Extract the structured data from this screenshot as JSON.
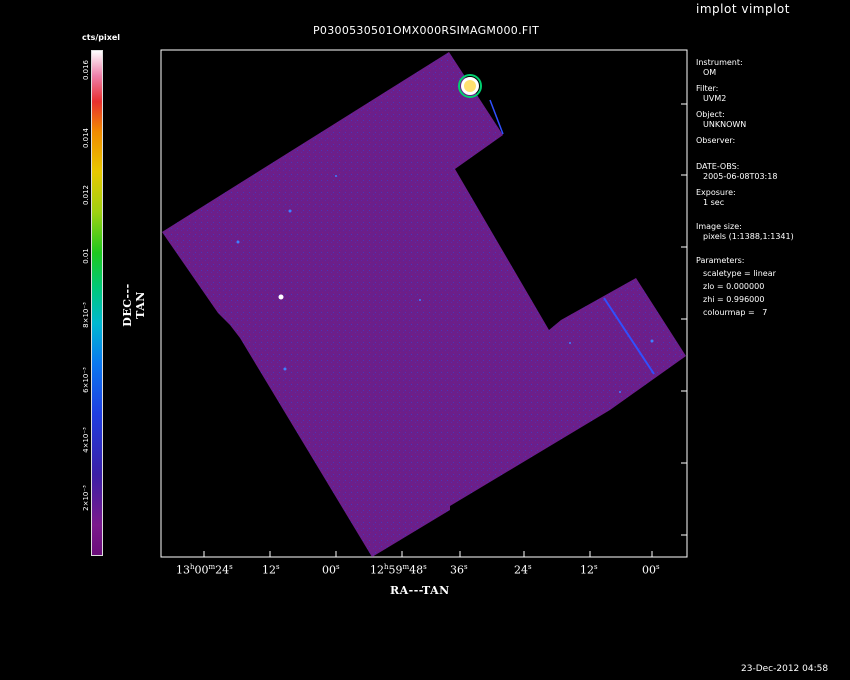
{
  "app_title": "implot vimplot",
  "plot_title": "P0300530501OMX000RSIMAGM000.FIT",
  "colorbar": {
    "unit_label": "cts/pixel",
    "ticks": [
      "0.016",
      "0.014",
      "0.012",
      "0.01",
      "8×10⁻³",
      "6×10⁻³",
      "4×10⁻³",
      "2×10⁻³"
    ]
  },
  "axes": {
    "y_label": "DEC---TAN",
    "x_label": "RA---TAN",
    "x_ticks": [
      {
        "main": "13",
        "h": "h",
        "min": "00",
        "m": "m",
        "sec": "24",
        "s": "s"
      },
      {
        "sec": "12",
        "s": "s"
      },
      {
        "sec": "00",
        "s": "s"
      },
      {
        "main": "12",
        "h": "h",
        "min": "59",
        "m": "m",
        "sec": "48",
        "s": "s"
      },
      {
        "sec": "36",
        "s": "s"
      },
      {
        "sec": "24",
        "s": "s"
      },
      {
        "sec": "12",
        "s": "s"
      },
      {
        "sec": "00",
        "s": "s"
      }
    ]
  },
  "info": {
    "instrument_key": "Instrument:",
    "instrument_val": "OM",
    "filter_key": "Filter:",
    "filter_val": "UVM2",
    "object_key": "Object:",
    "object_val": "UNKNOWN",
    "observer_key": "Observer:",
    "date_key": "DATE-OBS:",
    "date_val": "2005-06-08T03:18",
    "exposure_key": "Exposure:",
    "exposure_val": "1 sec",
    "image_size_key": "Image size:",
    "image_size_val": "pixels (1:1388,1:1341)",
    "parameters_key": "Parameters:",
    "param_scaletype": "scaletype = linear",
    "param_zlo": "zlo = 0.000000",
    "param_zhi": "zhi = 0.996000",
    "param_colourmap": "colourmap =   7"
  },
  "timestamp": "23-Dec-2012 04:58",
  "colors": {
    "image_fill": "#6b1f8a",
    "background": "#000000",
    "axis": "#ffffff"
  }
}
